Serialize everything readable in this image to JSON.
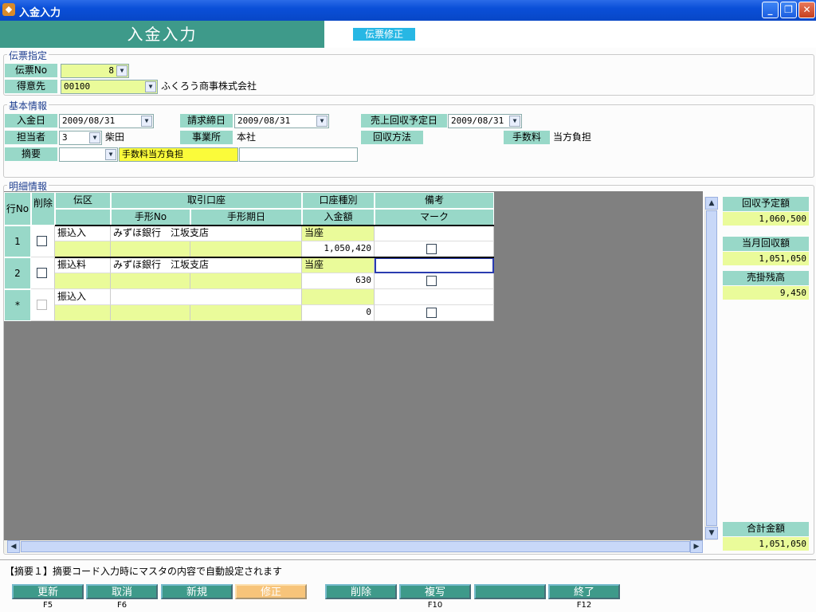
{
  "window": {
    "title": "入金入力",
    "icon": "app-icon",
    "buttons": {
      "minimize": "_",
      "restore": "❐",
      "close": "✕"
    }
  },
  "header": {
    "title": "入金入力",
    "mode_badge": "伝票修正"
  },
  "slip": {
    "group_title": "伝票指定",
    "no_label": "伝票No",
    "no_value": "8",
    "customer_label": "得意先",
    "customer_code": "00100",
    "customer_name": "ふくろう商事株式会社"
  },
  "basic": {
    "group_title": "基本情報",
    "payment_date_label": "入金日",
    "payment_date": "2009/08/31",
    "billing_close_label": "請求締日",
    "billing_close": "2009/08/31",
    "collection_plan_label": "売上回収予定日",
    "collection_plan": "2009/08/31",
    "staff_label": "担当者",
    "staff_code": "3",
    "staff_name": "柴田",
    "office_label": "事業所",
    "office_value": "本社",
    "method_label": "回収方法",
    "fee_label": "手数料",
    "fee_value": "当方負担",
    "summary_label": "摘要",
    "summary_code": "",
    "summary_text": "手数料当方負担",
    "summary_extra": ""
  },
  "detail": {
    "group_title": "明細情報",
    "headers": {
      "row_no": "行No",
      "delete": "削除",
      "slip_type": "伝区",
      "bank": "取引口座",
      "bill_no": "手形No",
      "bill_due": "手形期日",
      "account_type": "口座種別",
      "amount": "入金額",
      "note": "備考",
      "mark": "マーク"
    },
    "rows": [
      {
        "no": "1",
        "type": "振込入",
        "bank": "みずほ銀行　江坂支店",
        "account": "当座",
        "amount": "1,050,420"
      },
      {
        "no": "2",
        "type": "振込料",
        "bank": "みずほ銀行　江坂支店",
        "account": "当座",
        "amount": "630"
      },
      {
        "no": "*",
        "type": "振込入",
        "bank": "",
        "account": "",
        "amount": "0"
      }
    ]
  },
  "totals": {
    "planned_label": "回収予定額",
    "planned_value": "1,060,500",
    "month_label": "当月回収額",
    "month_value": "1,051,050",
    "balance_label": "売掛残高",
    "balance_value": "9,450",
    "sum_label": "合計金額",
    "sum_value": "1,051,050"
  },
  "status_text": "【摘要１】摘要コード入力時にマスタの内容で自動設定されます",
  "fkeys": [
    {
      "label": "更新",
      "key": "F5"
    },
    {
      "label": "取消",
      "key": "F6"
    },
    {
      "label": "新規",
      "key": ""
    },
    {
      "label": "修正",
      "key": ""
    },
    {
      "label": "削除",
      "key": ""
    },
    {
      "label": "複写",
      "key": "F10"
    },
    {
      "label": "",
      "key": ""
    },
    {
      "label": "終了",
      "key": "F12"
    }
  ]
}
